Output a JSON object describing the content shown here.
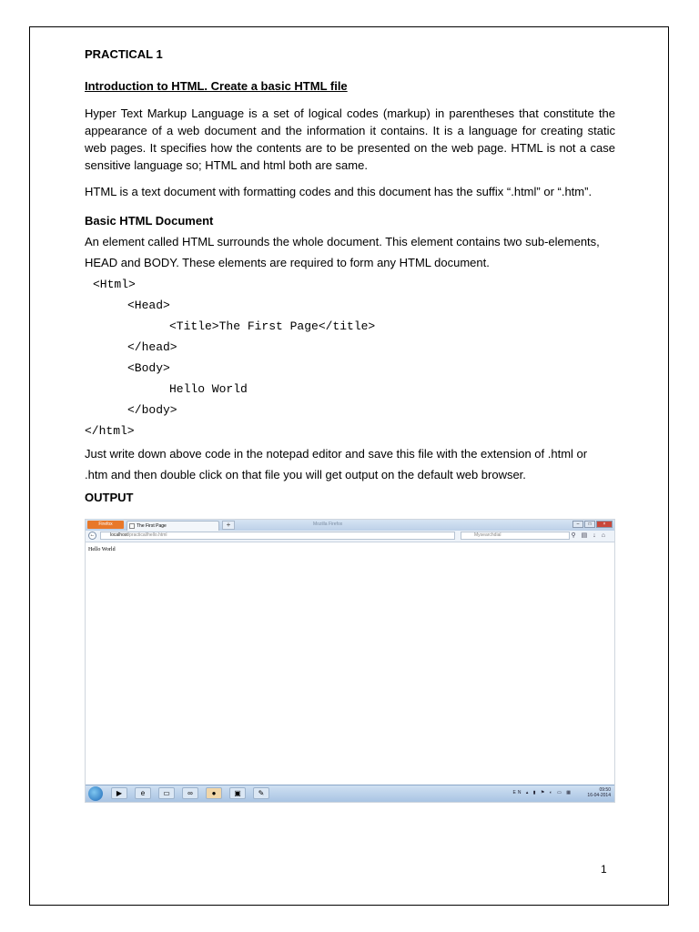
{
  "document": {
    "title": "PRACTICAL 1",
    "heading": "Introduction to HTML. Create a basic HTML file",
    "para1": "Hyper Text Markup Language is a set of logical codes (markup) in parentheses that constitute the appearance of a web document and the information it contains. It is a language for creating static web pages. It specifies how the contents are to be presented on the web page. HTML is not a case sensitive language so; HTML and html both are same.",
    "para2": "HTML is a text document with formatting codes and this document has the suffix “.html” or “.htm”.",
    "subheading": "Basic HTML Document",
    "line1": "An element called HTML surrounds the whole document. This element contains two sub-elements,",
    "line2": "HEAD and BODY. These elements are required to form any HTML document.",
    "code": [
      "<Html>",
      "<Head>",
      "<Title>The First Page</title>",
      "</head>",
      "<Body>",
      "Hello World",
      "</body>",
      "</html>"
    ],
    "line3": "Just write down above code in the notepad editor and save this file with the extension of .html or",
    "line4": ".htm and then double click on that file you will get output on the default web browser.",
    "output_label": "OUTPUT",
    "page_number": "1"
  },
  "screenshot": {
    "app_button": "Firefox",
    "tab_title": "The First Page",
    "window_title": "Mozilla Firefox",
    "url_host": "localhost",
    "url_path": "/practical/hello.html",
    "search_placeholder": "Mysearchdial",
    "page_text": "Hello World",
    "tray_lang": "EN",
    "clock_time": "09:50",
    "clock_date": "16-04-2014"
  }
}
